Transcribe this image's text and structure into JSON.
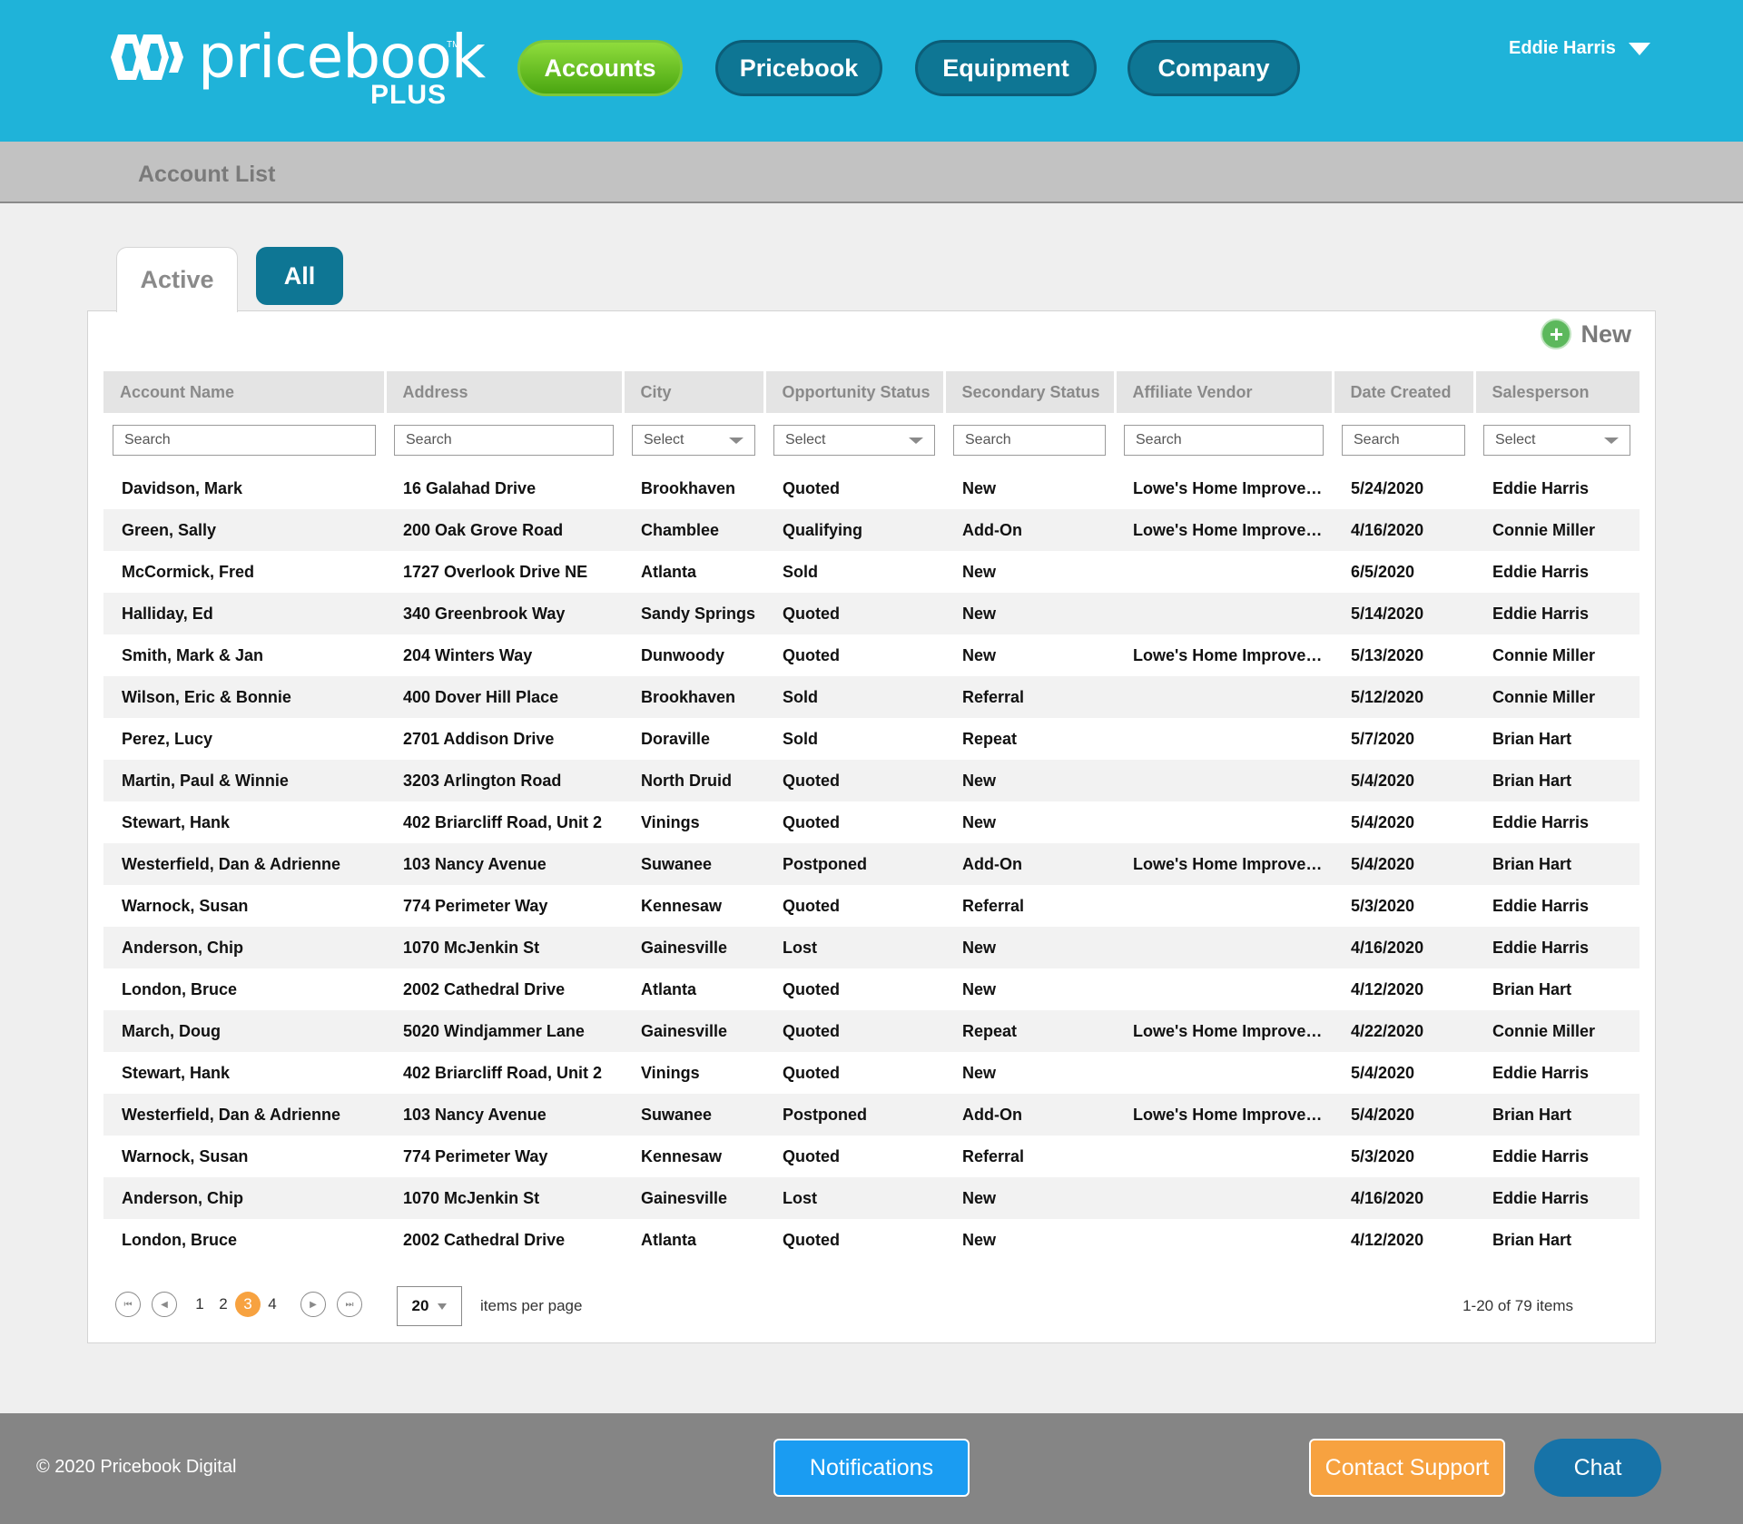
{
  "brand": {
    "name": "pricebook",
    "tm": "TM",
    "plus": "PLUS"
  },
  "nav": [
    {
      "label": "Accounts",
      "active": true
    },
    {
      "label": "Pricebook",
      "active": false
    },
    {
      "label": "Equipment",
      "active": false
    },
    {
      "label": "Company",
      "active": false
    }
  ],
  "user": {
    "name": "Eddie Harris"
  },
  "page": {
    "title": "Account List"
  },
  "tabs": {
    "active": "Active",
    "all": "All"
  },
  "toolbar": {
    "new_label": "New"
  },
  "table": {
    "columns": [
      "Account Name",
      "Address",
      "City",
      "Opportunity Status",
      "Secondary Status",
      "Affiliate Vendor",
      "Date Created",
      "Salesperson"
    ],
    "filters": [
      "Search",
      "Search",
      "Select",
      "Select",
      "Search",
      "Search",
      "Search",
      "Select"
    ],
    "rows": [
      [
        "Davidson, Mark",
        "16 Galahad Drive",
        "Brookhaven",
        "Quoted",
        "New",
        "Lowe's Home Improvement",
        "5/24/2020",
        "Eddie Harris"
      ],
      [
        "Green, Sally",
        "200 Oak Grove Road",
        "Chamblee",
        "Qualifying",
        "Add-On",
        "Lowe's Home Improvement",
        "4/16/2020",
        "Connie Miller"
      ],
      [
        "McCormick, Fred",
        "1727 Overlook Drive NE",
        "Atlanta",
        "Sold",
        "New",
        "",
        "6/5/2020",
        "Eddie Harris"
      ],
      [
        "Halliday, Ed",
        "340 Greenbrook Way",
        "Sandy Springs",
        "Quoted",
        "New",
        "",
        "5/14/2020",
        "Eddie Harris"
      ],
      [
        "Smith, Mark & Jan",
        "204 Winters Way",
        "Dunwoody",
        "Quoted",
        "New",
        "Lowe's Home Improvement",
        "5/13/2020",
        "Connie Miller"
      ],
      [
        "Wilson, Eric & Bonnie",
        "400 Dover Hill Place",
        "Brookhaven",
        "Sold",
        "Referral",
        "",
        "5/12/2020",
        "Connie Miller"
      ],
      [
        "Perez, Lucy",
        "2701 Addison Drive",
        "Doraville",
        "Sold",
        "Repeat",
        "",
        "5/7/2020",
        "Brian Hart"
      ],
      [
        "Martin, Paul & Winnie",
        "3203 Arlington Road",
        "North Druid",
        "Quoted",
        "New",
        "",
        "5/4/2020",
        "Brian Hart"
      ],
      [
        "Stewart, Hank",
        "402 Briarcliff Road, Unit 2",
        "Vinings",
        "Quoted",
        "New",
        "",
        "5/4/2020",
        "Eddie Harris"
      ],
      [
        "Westerfield, Dan & Adrienne",
        "103 Nancy Avenue",
        "Suwanee",
        "Postponed",
        "Add-On",
        "Lowe's Home Improvement",
        "5/4/2020",
        "Brian Hart"
      ],
      [
        "Warnock, Susan",
        "774 Perimeter Way",
        "Kennesaw",
        "Quoted",
        "Referral",
        "",
        "5/3/2020",
        "Eddie Harris"
      ],
      [
        "Anderson, Chip",
        "1070 McJenkin St",
        "Gainesville",
        "Lost",
        "New",
        "",
        "4/16/2020",
        "Eddie Harris"
      ],
      [
        "London, Bruce",
        "2002 Cathedral Drive",
        "Atlanta",
        "Quoted",
        "New",
        "",
        "4/12/2020",
        "Brian Hart"
      ],
      [
        "March, Doug",
        "5020 Windjammer Lane",
        "Gainesville",
        "Quoted",
        "Repeat",
        "Lowe's Home Improvement",
        "4/22/2020",
        "Connie Miller"
      ],
      [
        "Stewart, Hank",
        "402 Briarcliff Road, Unit 2",
        "Vinings",
        "Quoted",
        "New",
        "",
        "5/4/2020",
        "Eddie Harris"
      ],
      [
        "Westerfield, Dan & Adrienne",
        "103 Nancy Avenue",
        "Suwanee",
        "Postponed",
        "Add-On",
        "Lowe's Home Improvement",
        "5/4/2020",
        "Brian Hart"
      ],
      [
        "Warnock, Susan",
        "774 Perimeter Way",
        "Kennesaw",
        "Quoted",
        "Referral",
        "",
        "5/3/2020",
        "Eddie Harris"
      ],
      [
        "Anderson, Chip",
        "1070 McJenkin St",
        "Gainesville",
        "Lost",
        "New",
        "",
        "4/16/2020",
        "Eddie Harris"
      ],
      [
        "London, Bruce",
        "2002 Cathedral Drive",
        "Atlanta",
        "Quoted",
        "New",
        "",
        "4/12/2020",
        "Brian Hart"
      ]
    ]
  },
  "pagination": {
    "pages": [
      "1",
      "2",
      "3",
      "4"
    ],
    "current": "3",
    "per_page": "20",
    "per_page_label": "items per page",
    "item_count": "1-20 of 79 items"
  },
  "footer": {
    "copyright": "© 2020 Pricebook Digital",
    "notifications": "Notifications",
    "contact_support": "Contact Support",
    "chat": "Chat"
  },
  "colors": {
    "header": "#1fb3d9",
    "nav_button": "#0e7694",
    "nav_active": "#5cb82a",
    "current_page": "#f7a240",
    "notifications": "#1a9cf2",
    "support": "#f7a240",
    "chat": "#1773a8"
  }
}
